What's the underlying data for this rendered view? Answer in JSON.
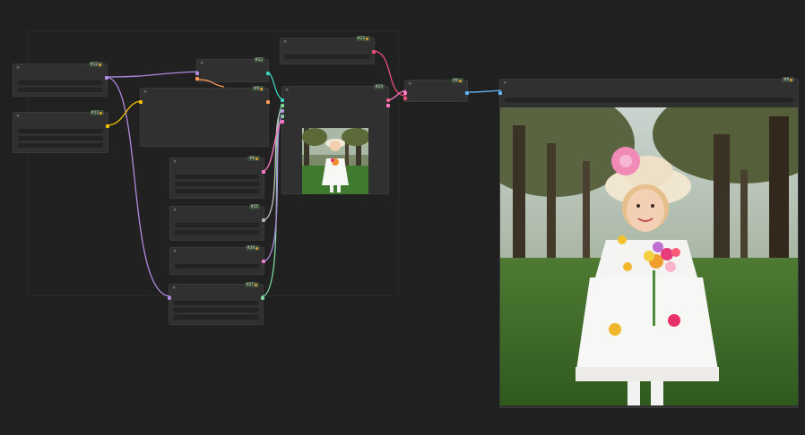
{
  "canvas": {
    "background": "#202020"
  },
  "nodes": [
    {
      "id": "node-1",
      "badge": "#12"
    },
    {
      "id": "node-2",
      "badge": "#13"
    },
    {
      "id": "node-3",
      "badge": "#22"
    },
    {
      "id": "node-4",
      "badge": "#9"
    },
    {
      "id": "node-5",
      "badge": "#23"
    },
    {
      "id": "node-6",
      "badge": "#24"
    },
    {
      "id": "node-7",
      "badge": "#8"
    },
    {
      "id": "node-8",
      "badge": "#25"
    },
    {
      "id": "node-9",
      "badge": "#26"
    },
    {
      "id": "node-10",
      "badge": "#27"
    },
    {
      "id": "node-11",
      "badge": "#6"
    },
    {
      "id": "node-12",
      "badge": "#9"
    }
  ],
  "wire_colors": {
    "clip": "#b08ae0",
    "vae": "#e94e77",
    "model": "#b08ae0",
    "conditioning": "#f0c000",
    "latent": "#ff9a5a",
    "image": "#64b5f6",
    "mask": "#7ed6a0",
    "teal": "#3fd0c0"
  },
  "preview": {
    "small_alt": "Girl in white dress holding flowers",
    "large_alt": "Girl in white dress and sun hat holding a flower bouquet in a park"
  }
}
